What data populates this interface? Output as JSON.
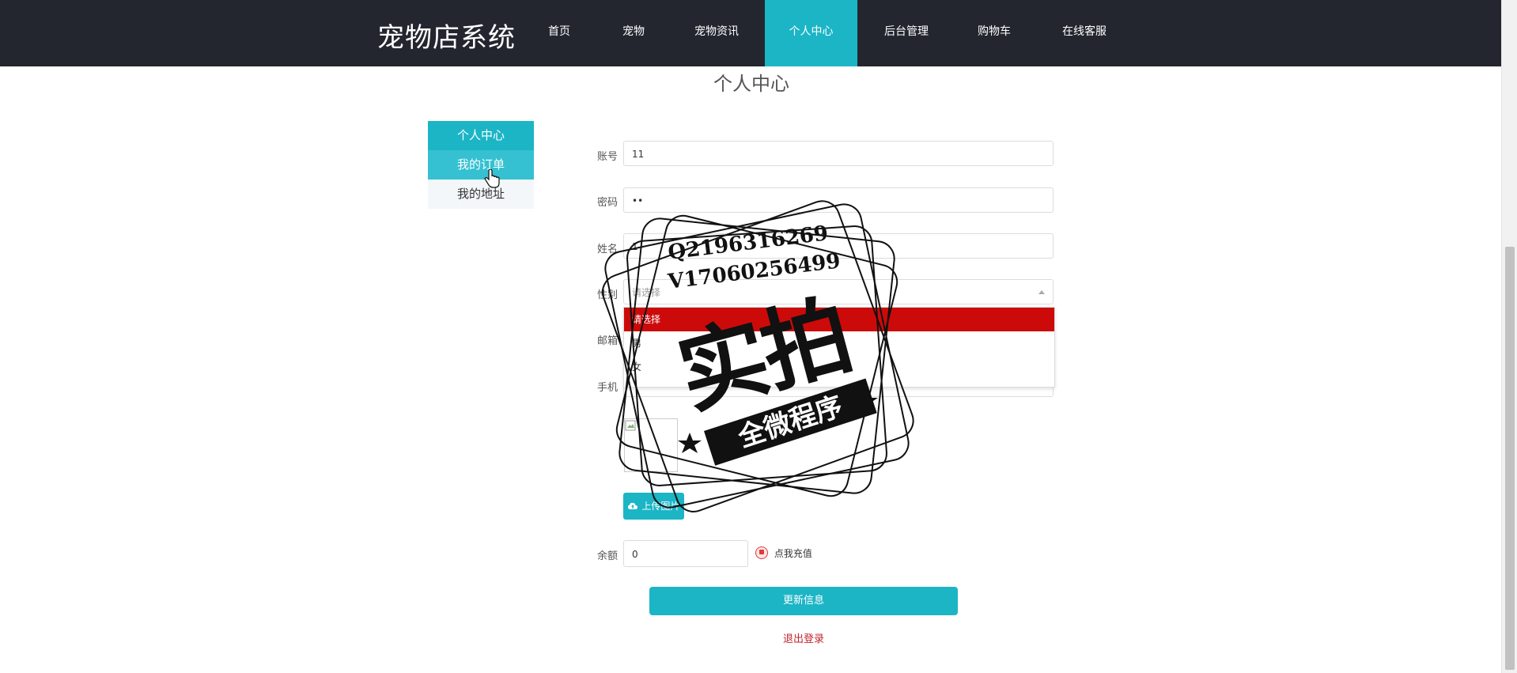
{
  "header": {
    "brand": "宠物店系统",
    "nav": [
      "首页",
      "宠物",
      "宠物资讯",
      "个人中心",
      "后台管理",
      "购物车",
      "在线客服"
    ],
    "active_nav": "个人中心"
  },
  "page": {
    "title": "个人中心"
  },
  "sidebar": {
    "items": [
      {
        "label": "个人中心"
      },
      {
        "label": "我的订单"
      },
      {
        "label": "我的地址"
      }
    ]
  },
  "form": {
    "account": {
      "label": "账号",
      "value": "11"
    },
    "password": {
      "label": "密码",
      "value": "••"
    },
    "name": {
      "label": "姓名",
      "value": "1"
    },
    "gender": {
      "label": "性别",
      "value": "请选择",
      "options": [
        "请选择",
        "男",
        "女"
      ]
    },
    "email": {
      "label": "邮箱"
    },
    "phone": {
      "label": "手机"
    },
    "upload_label": "上传图片",
    "balance": {
      "label": "余额",
      "value": "0",
      "recharge_label": "点我充值"
    },
    "update_label": "更新信息",
    "logout_label": "退出登录"
  },
  "watermark": {
    "line1": "Q2196316269",
    "line2": "V17060256499",
    "big_text": "实拍",
    "ribbon_text": "全微程序"
  },
  "colors": {
    "nav_bg": "#23262f",
    "accent": "#1cb5c6",
    "select_highlight": "#cc0a0a",
    "logout": "#c0272d"
  }
}
